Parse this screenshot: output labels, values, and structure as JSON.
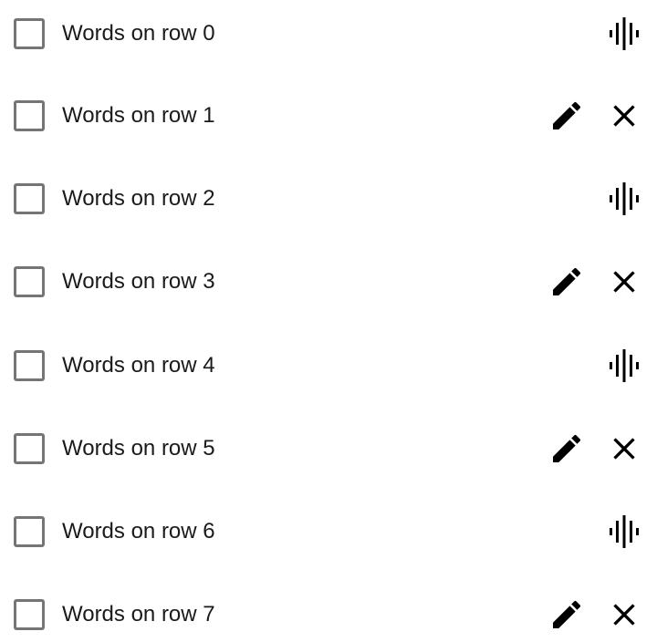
{
  "rows": [
    {
      "label": "Words on row 0",
      "checked": false,
      "actions": [
        "voice"
      ]
    },
    {
      "label": "Words on row 1",
      "checked": false,
      "actions": [
        "edit",
        "close"
      ]
    },
    {
      "label": "Words on row 2",
      "checked": false,
      "actions": [
        "voice"
      ]
    },
    {
      "label": "Words on row 3",
      "checked": false,
      "actions": [
        "edit",
        "close"
      ]
    },
    {
      "label": "Words on row 4",
      "checked": false,
      "actions": [
        "voice"
      ]
    },
    {
      "label": "Words on row 5",
      "checked": false,
      "actions": [
        "edit",
        "close"
      ]
    },
    {
      "label": "Words on row 6",
      "checked": false,
      "actions": [
        "voice"
      ]
    },
    {
      "label": "Words on row 7",
      "checked": false,
      "actions": [
        "edit",
        "close"
      ]
    }
  ],
  "icons": {
    "voice": "voice-waveform-icon",
    "edit": "pencil-icon",
    "close": "close-icon"
  },
  "colors": {
    "checkbox_border": "#757575",
    "text": "#1a1a1a",
    "icon": "#000000"
  }
}
